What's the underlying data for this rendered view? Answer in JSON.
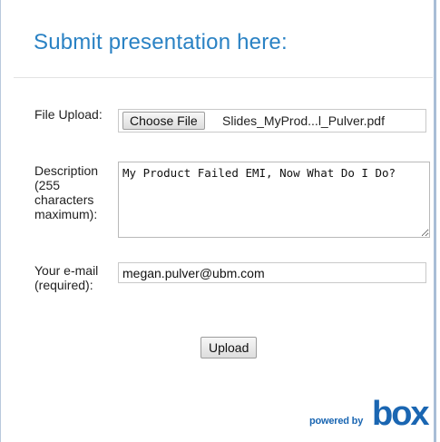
{
  "page": {
    "title": "Submit presentation here:"
  },
  "form": {
    "file": {
      "label": "File Upload:",
      "button_label": "Choose File",
      "file_name": "Slides_MyProd...l_Pulver.pdf"
    },
    "description": {
      "label": "Description (255 characters maximum):",
      "value": "My Product Failed EMI, Now What Do I Do?"
    },
    "email": {
      "label": "Your e-mail (required):",
      "value": "megan.pulver@ubm.com"
    },
    "submit_label": "Upload"
  },
  "footer": {
    "powered_by": "powered by",
    "brand": "box"
  },
  "colors": {
    "title": "#2a82c4",
    "brand": "#1a66b2"
  }
}
